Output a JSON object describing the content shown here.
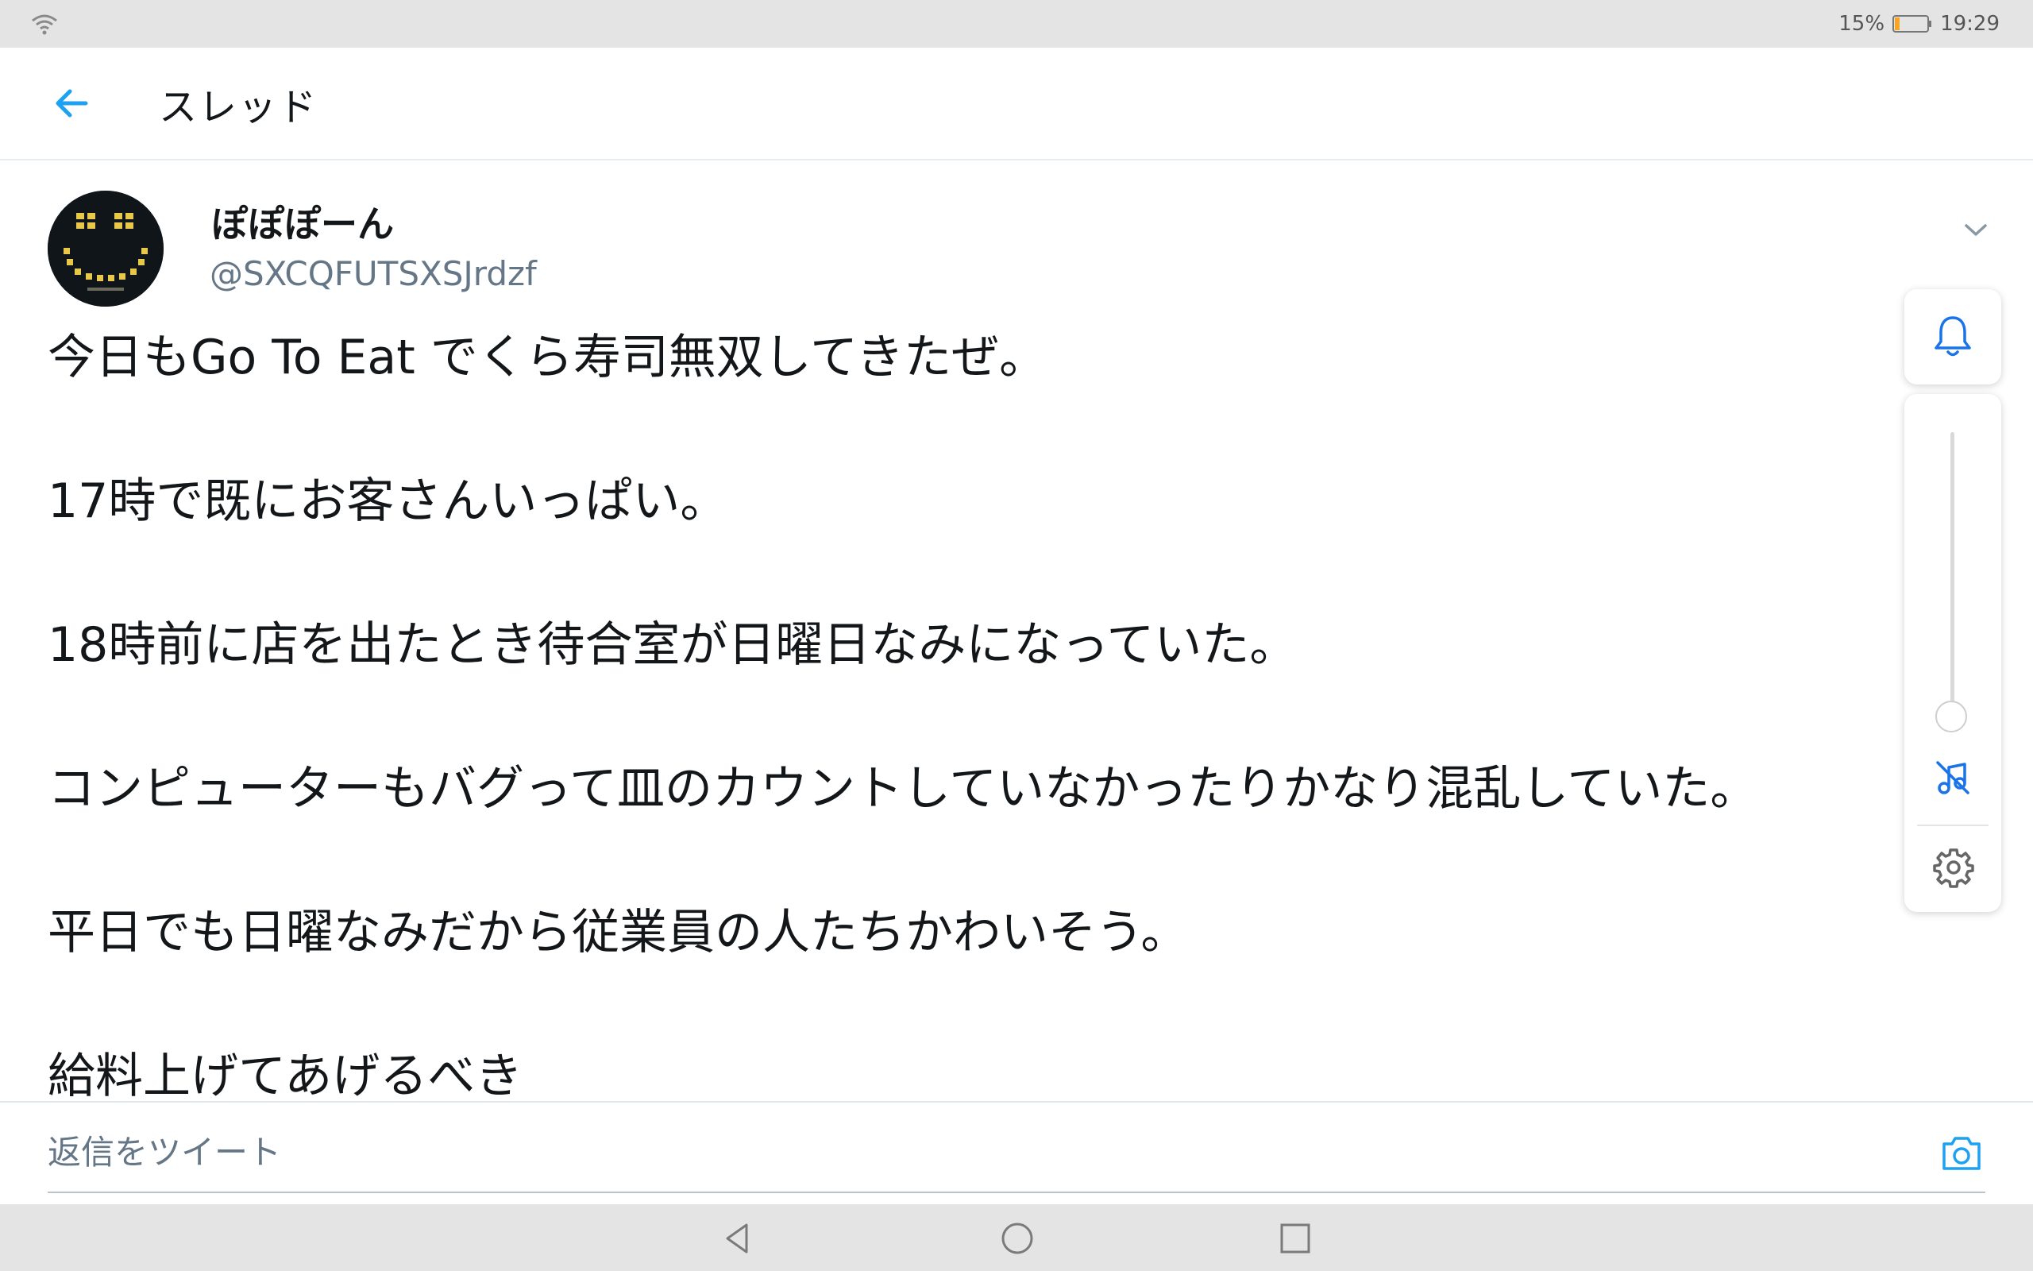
{
  "status_bar": {
    "battery": "15%",
    "time": "19:29",
    "battery_level": 0.15,
    "icons": [
      "wifi-icon",
      "battery-icon"
    ]
  },
  "app_bar": {
    "title": "スレッド",
    "back_icon": "arrow-left-icon"
  },
  "tweet": {
    "author_name": "ぽぽぽーん",
    "author_handle": "@SXCQFUTSXSJrdzf",
    "paragraphs": [
      "今日もGo To Eat でくら寿司無双してきたぜ。",
      "17時で既にお客さんいっぱい。",
      "18時前に店を出たとき待合室が日曜日なみになっていた。",
      "コンピューターもバグって皿のカウントしていなかったりかなり混乱していた。",
      "平日でも日曜なみだから従業員の人たちかわいそう。",
      "給料上げてあげるべき"
    ]
  },
  "floating_panel": {
    "icons": [
      "bell-icon",
      "volume-slider",
      "music-off-icon",
      "gear-icon"
    ],
    "volume_level": 0.0
  },
  "reply_bar": {
    "placeholder": "返信をツイート",
    "camera_icon": "camera-icon"
  },
  "nav_bar": {
    "icons": [
      "back-triangle-icon",
      "home-circle-icon",
      "recent-square-icon"
    ]
  },
  "colors": {
    "accent": "#1da1f2",
    "text": "#14171a",
    "secondary_text": "#657786",
    "battery_low": "#f5a623"
  }
}
